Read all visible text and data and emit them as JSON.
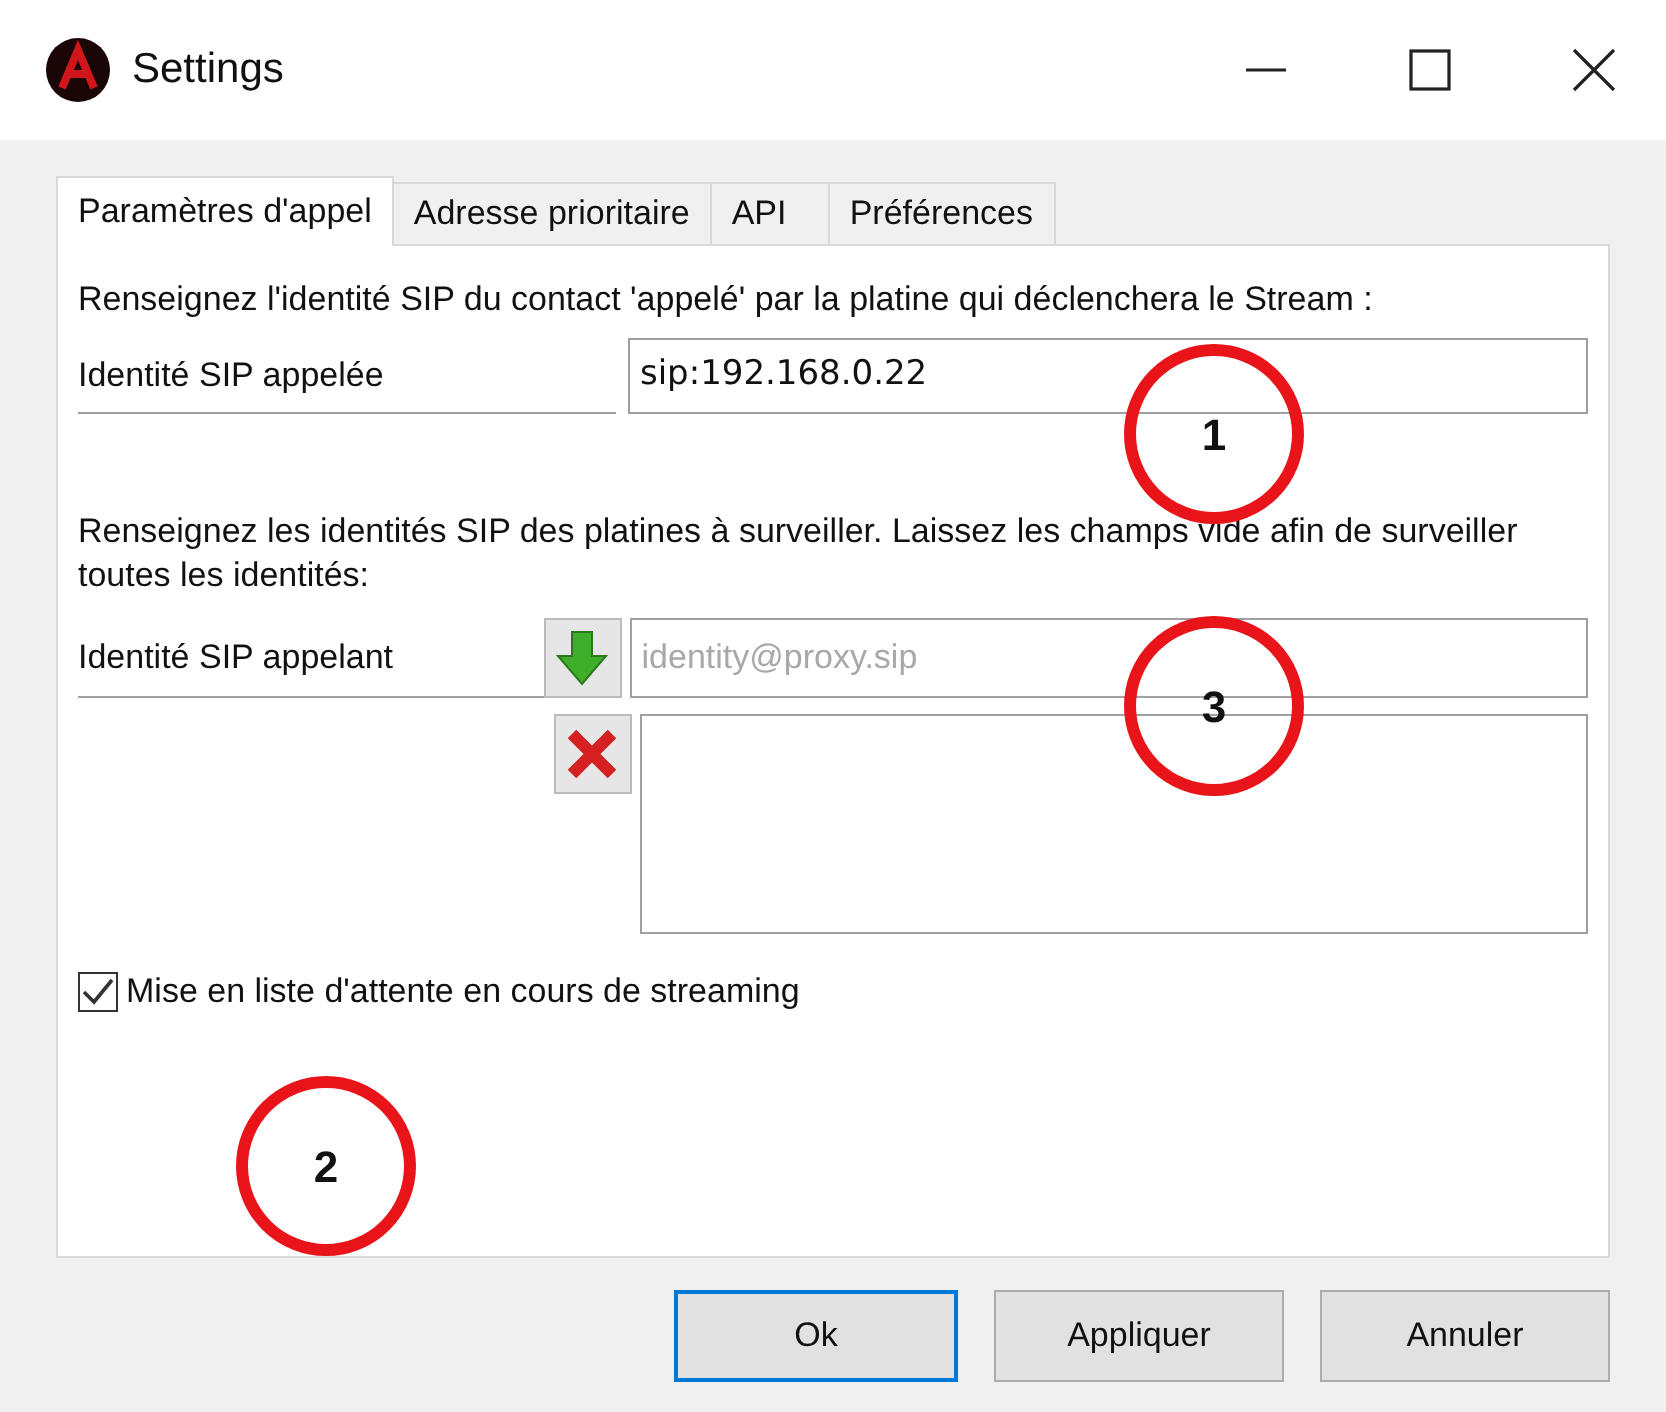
{
  "window": {
    "title": "Settings"
  },
  "tabs": [
    {
      "label": "Paramètres d'appel",
      "selected": true
    },
    {
      "label": "Adresse prioritaire",
      "selected": false
    },
    {
      "label": "API",
      "selected": false
    },
    {
      "label": "Préférences",
      "selected": false
    }
  ],
  "called": {
    "description": "Renseignez l'identité SIP du contact 'appelé' par la platine qui déclenchera le Stream :",
    "label": "Identité SIP appelée",
    "value": "sip:192.168.0.22"
  },
  "callers": {
    "description": "Renseignez les identités SIP des platines à surveiller. Laissez les champs vide afin de surveiller toutes les identités:",
    "label": "Identité SIP appelant",
    "placeholder": "identity@proxy.sip"
  },
  "queue_checkbox": {
    "label": "Mise en liste d'attente en cours de streaming",
    "checked": true
  },
  "buttons": [
    {
      "label": "Ok",
      "default": true
    },
    {
      "label": "Appliquer",
      "default": false
    },
    {
      "label": "Annuler",
      "default": false
    }
  ],
  "callouts": [
    {
      "number": "1"
    },
    {
      "number": "3"
    },
    {
      "number": "2"
    }
  ]
}
